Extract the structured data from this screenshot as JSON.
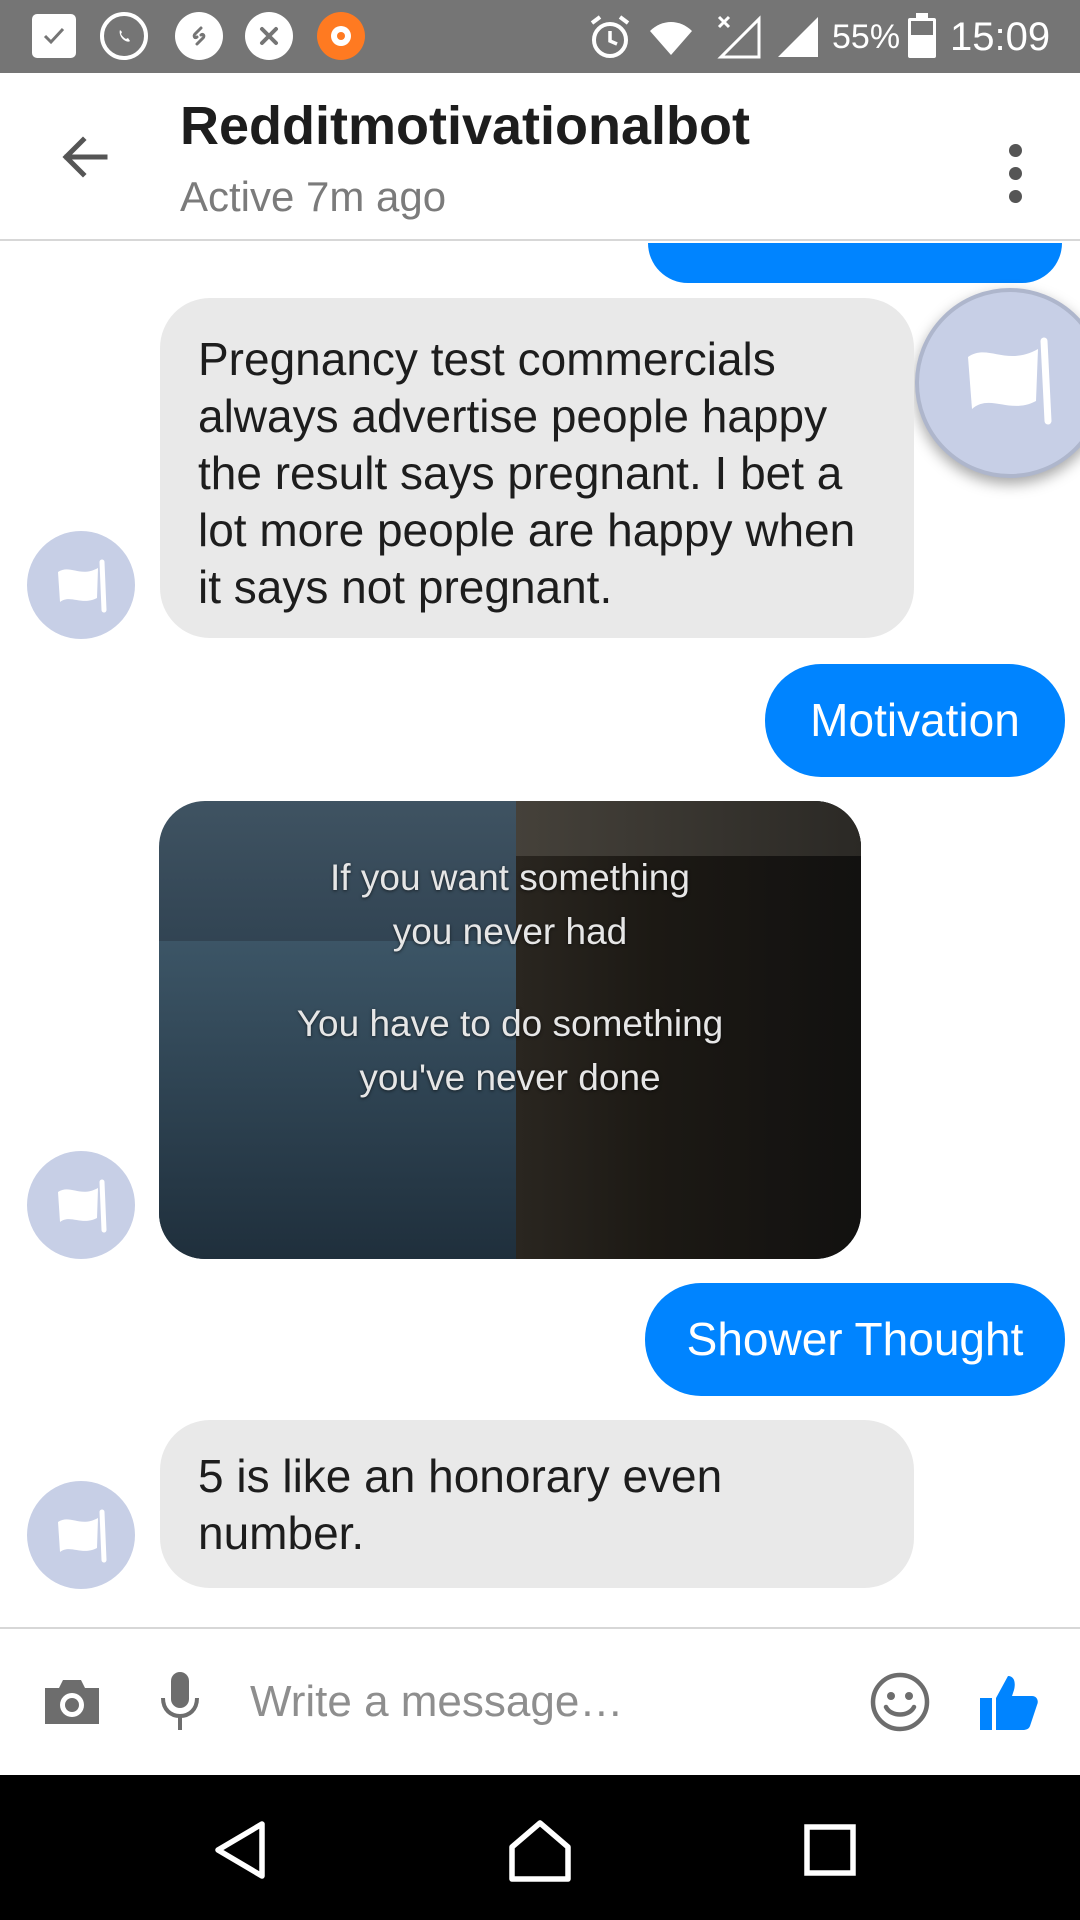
{
  "status_bar": {
    "icons": [
      "check-icon",
      "whatsapp-icon",
      "shazam-icon",
      "x-app-icon",
      "music-app-icon",
      "alarm-icon",
      "wifi-icon",
      "no-signal-icon",
      "signal-icon"
    ],
    "battery": "55%",
    "time": "15:09"
  },
  "header": {
    "title": "Redditmotivationalbot",
    "subtitle": "Active 7m ago",
    "back_icon": "arrow-left-icon",
    "menu_icon": "more-vertical-icon"
  },
  "conversation": {
    "messages": [
      {
        "from": "bot",
        "type": "text",
        "text": "Pregnancy test commercials always advertise people happy the result says pregnant. I bet a lot more people are happy when it says not pregnant."
      },
      {
        "from": "me",
        "type": "text",
        "text": "Motivation"
      },
      {
        "from": "bot",
        "type": "image",
        "lines": [
          "If you want something",
          "you never had",
          "You have to do something",
          "you've never done"
        ]
      },
      {
        "from": "me",
        "type": "text",
        "text": "Shower Thought"
      },
      {
        "from": "bot",
        "type": "text",
        "text": "5 is like an honorary even number."
      }
    ]
  },
  "composer": {
    "placeholder": "Write a message…",
    "icons": [
      "camera-icon",
      "microphone-icon",
      "emoji-icon",
      "thumbs-up-icon"
    ]
  },
  "nav_bar": {
    "icons": [
      "back-triangle-icon",
      "home-icon",
      "recent-apps-icon"
    ]
  },
  "colors": {
    "accent": "#0084ff",
    "incoming_bubble": "#e9e9e9",
    "avatar": "#c7cfe6",
    "status_bar": "#757575"
  }
}
